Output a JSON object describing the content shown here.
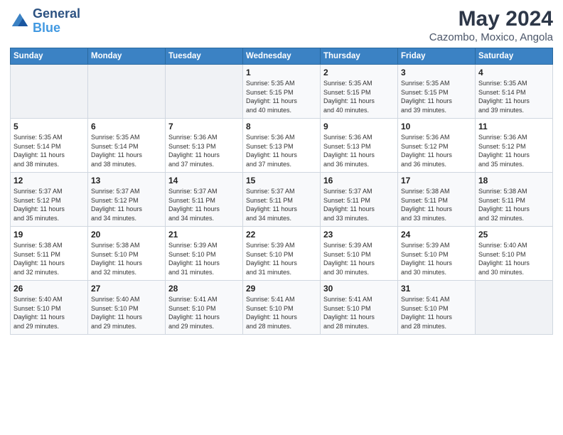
{
  "logo": {
    "line1": "General",
    "line2": "Blue"
  },
  "title": "May 2024",
  "subtitle": "Cazombo, Moxico, Angola",
  "days_header": [
    "Sunday",
    "Monday",
    "Tuesday",
    "Wednesday",
    "Thursday",
    "Friday",
    "Saturday"
  ],
  "weeks": [
    {
      "cells": [
        {
          "day": "",
          "info": ""
        },
        {
          "day": "",
          "info": ""
        },
        {
          "day": "",
          "info": ""
        },
        {
          "day": "1",
          "info": "Sunrise: 5:35 AM\nSunset: 5:15 PM\nDaylight: 11 hours\nand 40 minutes."
        },
        {
          "day": "2",
          "info": "Sunrise: 5:35 AM\nSunset: 5:15 PM\nDaylight: 11 hours\nand 40 minutes."
        },
        {
          "day": "3",
          "info": "Sunrise: 5:35 AM\nSunset: 5:15 PM\nDaylight: 11 hours\nand 39 minutes."
        },
        {
          "day": "4",
          "info": "Sunrise: 5:35 AM\nSunset: 5:14 PM\nDaylight: 11 hours\nand 39 minutes."
        }
      ]
    },
    {
      "cells": [
        {
          "day": "5",
          "info": "Sunrise: 5:35 AM\nSunset: 5:14 PM\nDaylight: 11 hours\nand 38 minutes."
        },
        {
          "day": "6",
          "info": "Sunrise: 5:35 AM\nSunset: 5:14 PM\nDaylight: 11 hours\nand 38 minutes."
        },
        {
          "day": "7",
          "info": "Sunrise: 5:36 AM\nSunset: 5:13 PM\nDaylight: 11 hours\nand 37 minutes."
        },
        {
          "day": "8",
          "info": "Sunrise: 5:36 AM\nSunset: 5:13 PM\nDaylight: 11 hours\nand 37 minutes."
        },
        {
          "day": "9",
          "info": "Sunrise: 5:36 AM\nSunset: 5:13 PM\nDaylight: 11 hours\nand 36 minutes."
        },
        {
          "day": "10",
          "info": "Sunrise: 5:36 AM\nSunset: 5:12 PM\nDaylight: 11 hours\nand 36 minutes."
        },
        {
          "day": "11",
          "info": "Sunrise: 5:36 AM\nSunset: 5:12 PM\nDaylight: 11 hours\nand 35 minutes."
        }
      ]
    },
    {
      "cells": [
        {
          "day": "12",
          "info": "Sunrise: 5:37 AM\nSunset: 5:12 PM\nDaylight: 11 hours\nand 35 minutes."
        },
        {
          "day": "13",
          "info": "Sunrise: 5:37 AM\nSunset: 5:12 PM\nDaylight: 11 hours\nand 34 minutes."
        },
        {
          "day": "14",
          "info": "Sunrise: 5:37 AM\nSunset: 5:11 PM\nDaylight: 11 hours\nand 34 minutes."
        },
        {
          "day": "15",
          "info": "Sunrise: 5:37 AM\nSunset: 5:11 PM\nDaylight: 11 hours\nand 34 minutes."
        },
        {
          "day": "16",
          "info": "Sunrise: 5:37 AM\nSunset: 5:11 PM\nDaylight: 11 hours\nand 33 minutes."
        },
        {
          "day": "17",
          "info": "Sunrise: 5:38 AM\nSunset: 5:11 PM\nDaylight: 11 hours\nand 33 minutes."
        },
        {
          "day": "18",
          "info": "Sunrise: 5:38 AM\nSunset: 5:11 PM\nDaylight: 11 hours\nand 32 minutes."
        }
      ]
    },
    {
      "cells": [
        {
          "day": "19",
          "info": "Sunrise: 5:38 AM\nSunset: 5:11 PM\nDaylight: 11 hours\nand 32 minutes."
        },
        {
          "day": "20",
          "info": "Sunrise: 5:38 AM\nSunset: 5:10 PM\nDaylight: 11 hours\nand 32 minutes."
        },
        {
          "day": "21",
          "info": "Sunrise: 5:39 AM\nSunset: 5:10 PM\nDaylight: 11 hours\nand 31 minutes."
        },
        {
          "day": "22",
          "info": "Sunrise: 5:39 AM\nSunset: 5:10 PM\nDaylight: 11 hours\nand 31 minutes."
        },
        {
          "day": "23",
          "info": "Sunrise: 5:39 AM\nSunset: 5:10 PM\nDaylight: 11 hours\nand 30 minutes."
        },
        {
          "day": "24",
          "info": "Sunrise: 5:39 AM\nSunset: 5:10 PM\nDaylight: 11 hours\nand 30 minutes."
        },
        {
          "day": "25",
          "info": "Sunrise: 5:40 AM\nSunset: 5:10 PM\nDaylight: 11 hours\nand 30 minutes."
        }
      ]
    },
    {
      "cells": [
        {
          "day": "26",
          "info": "Sunrise: 5:40 AM\nSunset: 5:10 PM\nDaylight: 11 hours\nand 29 minutes."
        },
        {
          "day": "27",
          "info": "Sunrise: 5:40 AM\nSunset: 5:10 PM\nDaylight: 11 hours\nand 29 minutes."
        },
        {
          "day": "28",
          "info": "Sunrise: 5:41 AM\nSunset: 5:10 PM\nDaylight: 11 hours\nand 29 minutes."
        },
        {
          "day": "29",
          "info": "Sunrise: 5:41 AM\nSunset: 5:10 PM\nDaylight: 11 hours\nand 28 minutes."
        },
        {
          "day": "30",
          "info": "Sunrise: 5:41 AM\nSunset: 5:10 PM\nDaylight: 11 hours\nand 28 minutes."
        },
        {
          "day": "31",
          "info": "Sunrise: 5:41 AM\nSunset: 5:10 PM\nDaylight: 11 hours\nand 28 minutes."
        },
        {
          "day": "",
          "info": ""
        }
      ]
    }
  ]
}
